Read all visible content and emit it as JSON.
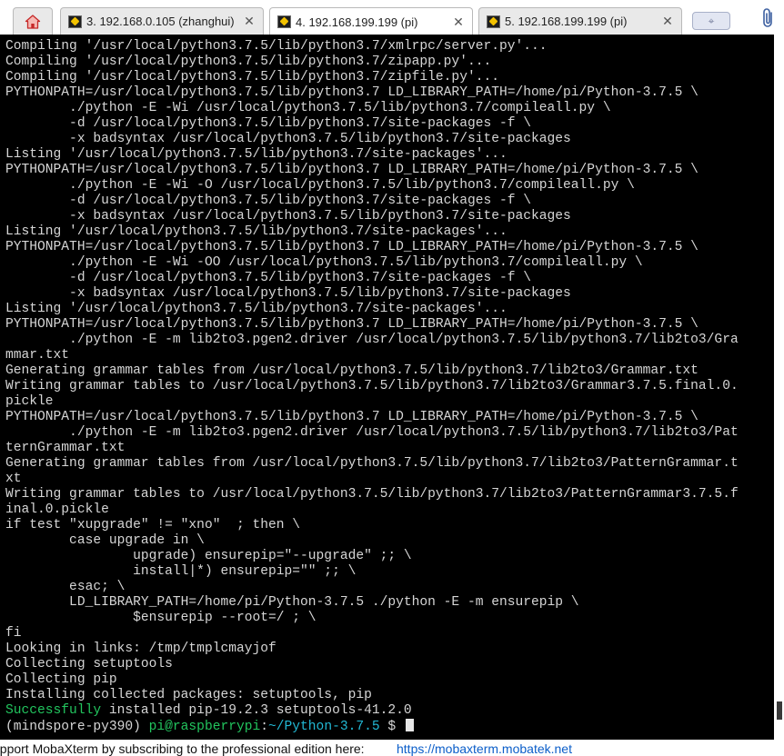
{
  "tabs": [
    {
      "name": "tab-home",
      "label": "",
      "icon": "home-icon",
      "active": false
    },
    {
      "name": "tab-session-3",
      "label": "3. 192.168.0.105 (zhanghui)",
      "icon": "terminal-session-icon",
      "active": false
    },
    {
      "name": "tab-session-4",
      "label": "4. 192.168.199.199 (pi)",
      "icon": "terminal-session-icon",
      "active": true
    },
    {
      "name": "tab-session-5",
      "label": "5. 192.168.199.199 (pi)",
      "icon": "terminal-session-icon",
      "active": false
    }
  ],
  "toolbar": {
    "new_tab_label": "⌖",
    "attach_icon": "paperclip-icon"
  },
  "colors": {
    "terminal_bg": "#000000",
    "text": "#d6d6d6",
    "success": "#22c55e",
    "prompt_path": "#22b8d4",
    "link": "#0b5ec9"
  },
  "terminal": {
    "lines": [
      "Compiling '/usr/local/python3.7.5/lib/python3.7/xmlrpc/server.py'...",
      "Compiling '/usr/local/python3.7.5/lib/python3.7/zipapp.py'...",
      "Compiling '/usr/local/python3.7.5/lib/python3.7/zipfile.py'...",
      "PYTHONPATH=/usr/local/python3.7.5/lib/python3.7 LD_LIBRARY_PATH=/home/pi/Python-3.7.5 \\",
      "        ./python -E -Wi /usr/local/python3.7.5/lib/python3.7/compileall.py \\",
      "        -d /usr/local/python3.7.5/lib/python3.7/site-packages -f \\",
      "        -x badsyntax /usr/local/python3.7.5/lib/python3.7/site-packages",
      "Listing '/usr/local/python3.7.5/lib/python3.7/site-packages'...",
      "PYTHONPATH=/usr/local/python3.7.5/lib/python3.7 LD_LIBRARY_PATH=/home/pi/Python-3.7.5 \\",
      "        ./python -E -Wi -O /usr/local/python3.7.5/lib/python3.7/compileall.py \\",
      "        -d /usr/local/python3.7.5/lib/python3.7/site-packages -f \\",
      "        -x badsyntax /usr/local/python3.7.5/lib/python3.7/site-packages",
      "Listing '/usr/local/python3.7.5/lib/python3.7/site-packages'...",
      "PYTHONPATH=/usr/local/python3.7.5/lib/python3.7 LD_LIBRARY_PATH=/home/pi/Python-3.7.5 \\",
      "        ./python -E -Wi -OO /usr/local/python3.7.5/lib/python3.7/compileall.py \\",
      "        -d /usr/local/python3.7.5/lib/python3.7/site-packages -f \\",
      "        -x badsyntax /usr/local/python3.7.5/lib/python3.7/site-packages",
      "Listing '/usr/local/python3.7.5/lib/python3.7/site-packages'...",
      "PYTHONPATH=/usr/local/python3.7.5/lib/python3.7 LD_LIBRARY_PATH=/home/pi/Python-3.7.5 \\",
      "        ./python -E -m lib2to3.pgen2.driver /usr/local/python3.7.5/lib/python3.7/lib2to3/Gra",
      "mmar.txt",
      "Generating grammar tables from /usr/local/python3.7.5/lib/python3.7/lib2to3/Grammar.txt",
      "Writing grammar tables to /usr/local/python3.7.5/lib/python3.7/lib2to3/Grammar3.7.5.final.0.",
      "pickle",
      "PYTHONPATH=/usr/local/python3.7.5/lib/python3.7 LD_LIBRARY_PATH=/home/pi/Python-3.7.5 \\",
      "        ./python -E -m lib2to3.pgen2.driver /usr/local/python3.7.5/lib/python3.7/lib2to3/Pat",
      "ternGrammar.txt",
      "Generating grammar tables from /usr/local/python3.7.5/lib/python3.7/lib2to3/PatternGrammar.t",
      "xt",
      "Writing grammar tables to /usr/local/python3.7.5/lib/python3.7/lib2to3/PatternGrammar3.7.5.f",
      "inal.0.pickle",
      "if test \"xupgrade\" != \"xno\"  ; then \\",
      "        case upgrade in \\",
      "                upgrade) ensurepip=\"--upgrade\" ;; \\",
      "                install|*) ensurepip=\"\" ;; \\",
      "        esac; \\",
      "        LD_LIBRARY_PATH=/home/pi/Python-3.7.5 ./python -E -m ensurepip \\",
      "                $ensurepip --root=/ ; \\",
      "fi",
      "Looking in links: /tmp/tmplcmayjof",
      "Collecting setuptools",
      "Collecting pip",
      "Installing collected packages: setuptools, pip"
    ],
    "success_word": "Successfully",
    "success_rest": " installed pip-19.2.3 setuptools-41.2.0",
    "prompt": {
      "env": "(mindspore-py390) ",
      "user_host": "pi@raspberrypi",
      "sep": ":",
      "path": "~/Python-3.7.5",
      "symbol": " $ "
    }
  },
  "footer": {
    "text": "upport MobaXterm by subscribing to the professional edition here:",
    "link": "https://mobaxterm.mobatek.net"
  }
}
